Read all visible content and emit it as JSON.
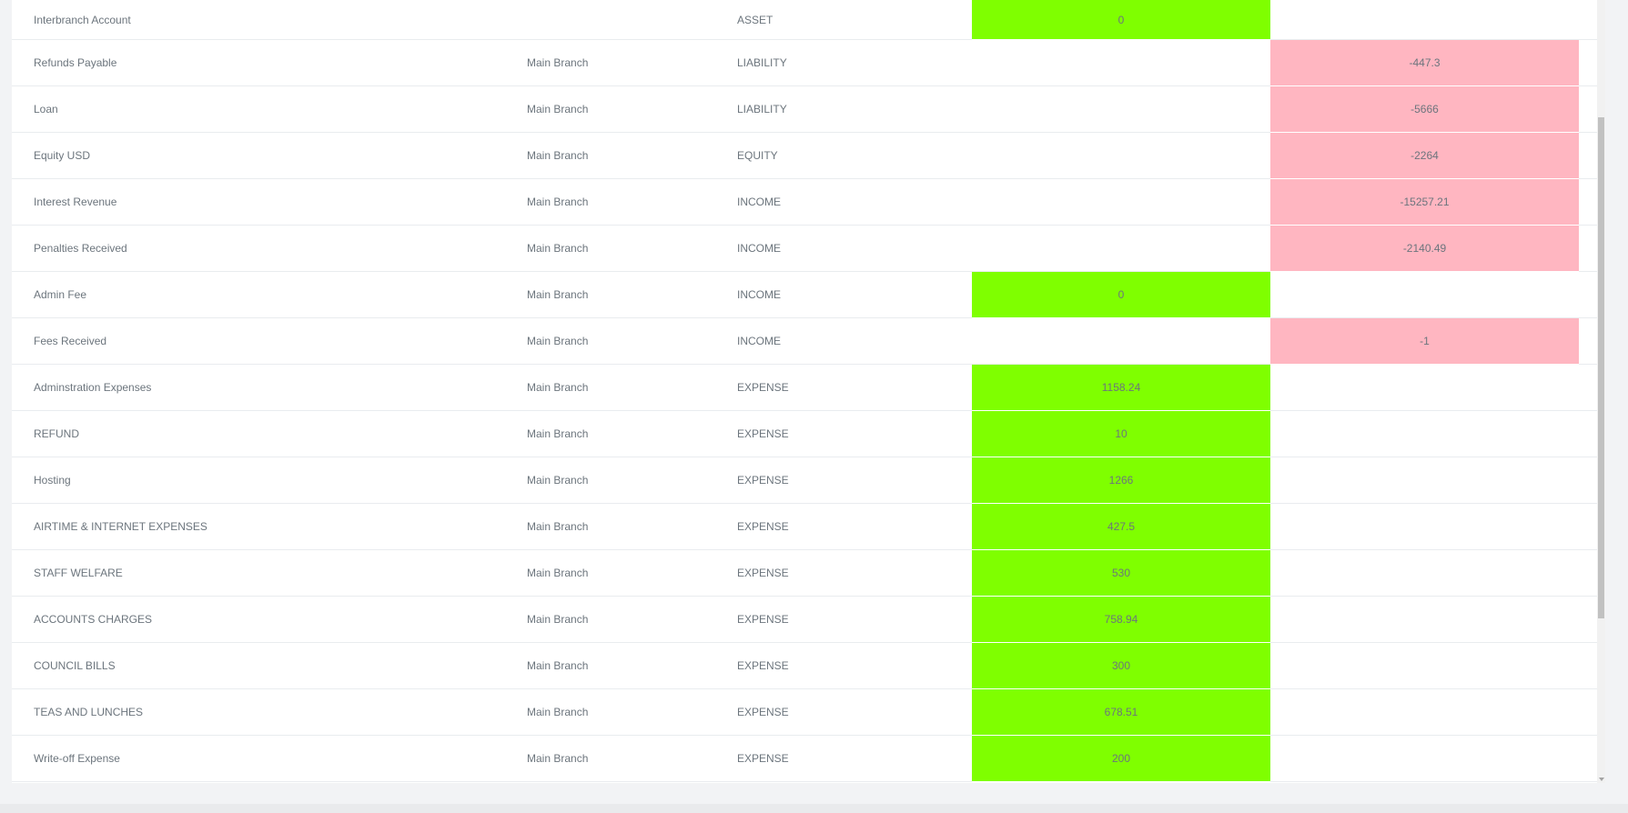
{
  "table": {
    "rows": [
      {
        "name": "Interbranch Account",
        "branch": "",
        "type": "ASSET",
        "debit": "0",
        "credit": ""
      },
      {
        "name": "Refunds Payable",
        "branch": "Main Branch",
        "type": "LIABILITY",
        "debit": "",
        "credit": "-447.3"
      },
      {
        "name": "Loan",
        "branch": "Main Branch",
        "type": "LIABILITY",
        "debit": "",
        "credit": "-5666"
      },
      {
        "name": "Equity USD",
        "branch": "Main Branch",
        "type": "EQUITY",
        "debit": "",
        "credit": "-2264"
      },
      {
        "name": "Interest Revenue",
        "branch": "Main Branch",
        "type": "INCOME",
        "debit": "",
        "credit": "-15257.21"
      },
      {
        "name": "Penalties Received",
        "branch": "Main Branch",
        "type": "INCOME",
        "debit": "",
        "credit": "-2140.49"
      },
      {
        "name": "Admin Fee",
        "branch": "Main Branch",
        "type": "INCOME",
        "debit": "0",
        "credit": ""
      },
      {
        "name": "Fees Received",
        "branch": "Main Branch",
        "type": "INCOME",
        "debit": "",
        "credit": "-1"
      },
      {
        "name": "Adminstration Expenses",
        "branch": "Main Branch",
        "type": "EXPENSE",
        "debit": "1158.24",
        "credit": ""
      },
      {
        "name": "REFUND",
        "branch": "Main Branch",
        "type": "EXPENSE",
        "debit": "10",
        "credit": ""
      },
      {
        "name": "Hosting",
        "branch": "Main Branch",
        "type": "EXPENSE",
        "debit": "1266",
        "credit": ""
      },
      {
        "name": "AIRTIME & INTERNET EXPENSES",
        "branch": "Main Branch",
        "type": "EXPENSE",
        "debit": "427.5",
        "credit": ""
      },
      {
        "name": "STAFF WELFARE",
        "branch": "Main Branch",
        "type": "EXPENSE",
        "debit": "530",
        "credit": ""
      },
      {
        "name": "ACCOUNTS CHARGES",
        "branch": "Main Branch",
        "type": "EXPENSE",
        "debit": "758.94",
        "credit": ""
      },
      {
        "name": "COUNCIL BILLS",
        "branch": "Main Branch",
        "type": "EXPENSE",
        "debit": "300",
        "credit": ""
      },
      {
        "name": "TEAS AND LUNCHES",
        "branch": "Main Branch",
        "type": "EXPENSE",
        "debit": "678.51",
        "credit": ""
      },
      {
        "name": "Write-off Expense",
        "branch": "Main Branch",
        "type": "EXPENSE",
        "debit": "200",
        "credit": ""
      }
    ]
  },
  "colors": {
    "debit_fill": "#7fff00",
    "credit_fill": "#ffb6c1",
    "text": "#6c757d"
  },
  "scrollbar": {
    "position_fraction": 0.15,
    "visible_fraction": 0.64
  }
}
